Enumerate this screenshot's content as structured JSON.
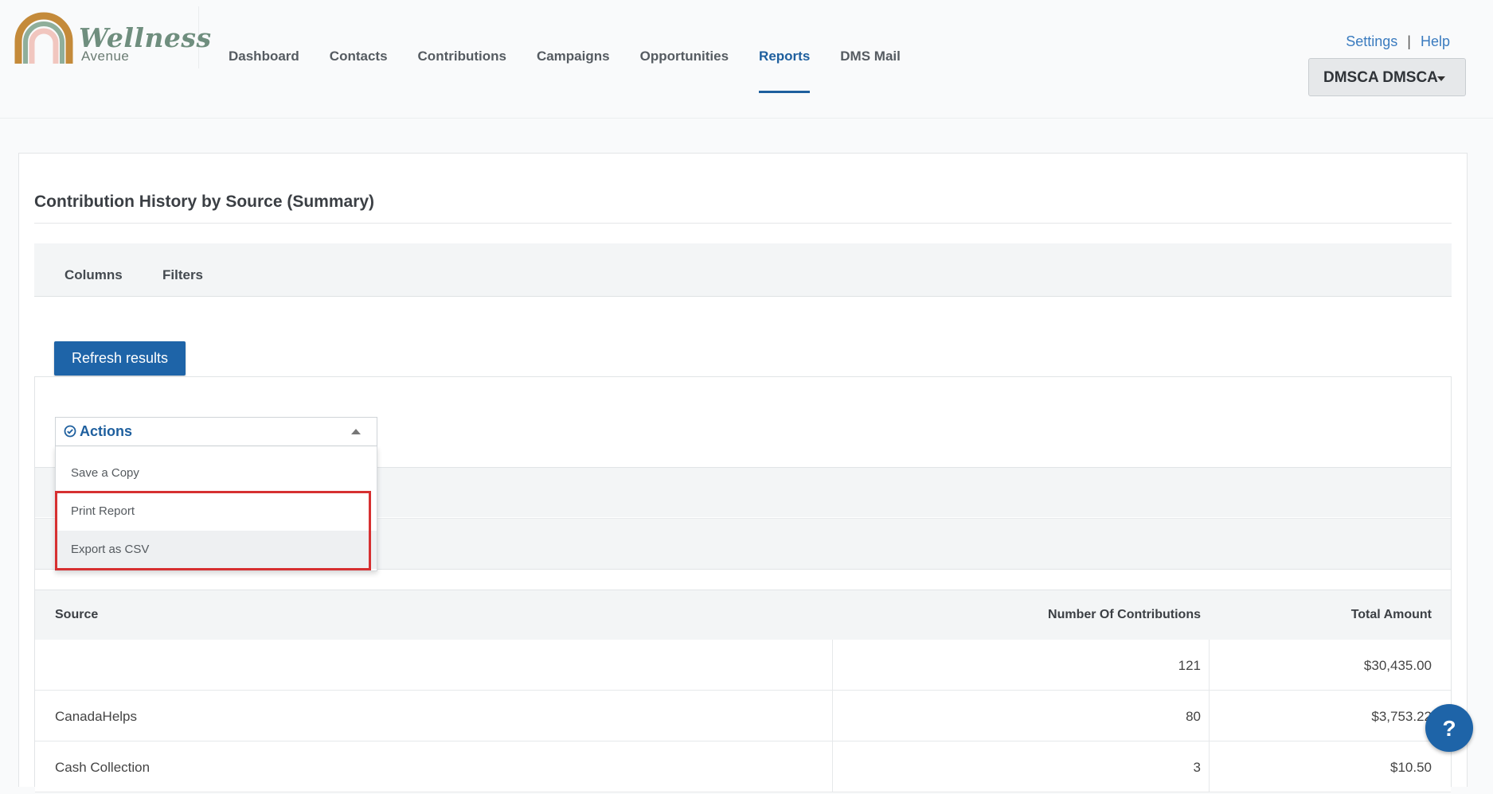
{
  "brand": {
    "name": "Wellness",
    "subtitle": "Avenue",
    "colors": {
      "arc_outer": "#c48a3a",
      "arc_middle": "#8fae9a",
      "arc_inner": "#f1c6bf",
      "word": "#6f8e7e"
    }
  },
  "nav": {
    "items": [
      {
        "label": "Dashboard",
        "active": false
      },
      {
        "label": "Contacts",
        "active": false
      },
      {
        "label": "Contributions",
        "active": false
      },
      {
        "label": "Campaigns",
        "active": false
      },
      {
        "label": "Opportunities",
        "active": false
      },
      {
        "label": "Reports",
        "active": true
      },
      {
        "label": "DMS Mail",
        "active": false
      }
    ]
  },
  "toplinks": {
    "settings": "Settings",
    "separator": "|",
    "help": "Help"
  },
  "user": {
    "name": "DMSCA DMSCA"
  },
  "page": {
    "title": "Contribution History by Source (Summary)"
  },
  "tabs": {
    "columns": "Columns",
    "filters": "Filters"
  },
  "refresh": {
    "label": "Refresh results"
  },
  "actions": {
    "label": "Actions",
    "icon": "check-circle-icon",
    "menu": [
      {
        "label": "Save a Copy",
        "highlighted": false
      },
      {
        "label": "Print Report",
        "highlighted": false
      },
      {
        "label": "Export as CSV",
        "highlighted": true
      }
    ]
  },
  "table": {
    "headers": {
      "source": "Source",
      "count": "Number Of Contributions",
      "total": "Total Amount"
    },
    "rows": [
      {
        "source": "",
        "count": "121",
        "total": "$30,435.00"
      },
      {
        "source": "CanadaHelps",
        "count": "80",
        "total": "$3,753.22"
      },
      {
        "source": "Cash Collection",
        "count": "3",
        "total": "$10.50"
      }
    ]
  },
  "help_button": {
    "label": "?"
  },
  "colors": {
    "primary": "#1e64a8",
    "nav_active": "#1e5f9e",
    "highlight_border": "#d63031"
  }
}
